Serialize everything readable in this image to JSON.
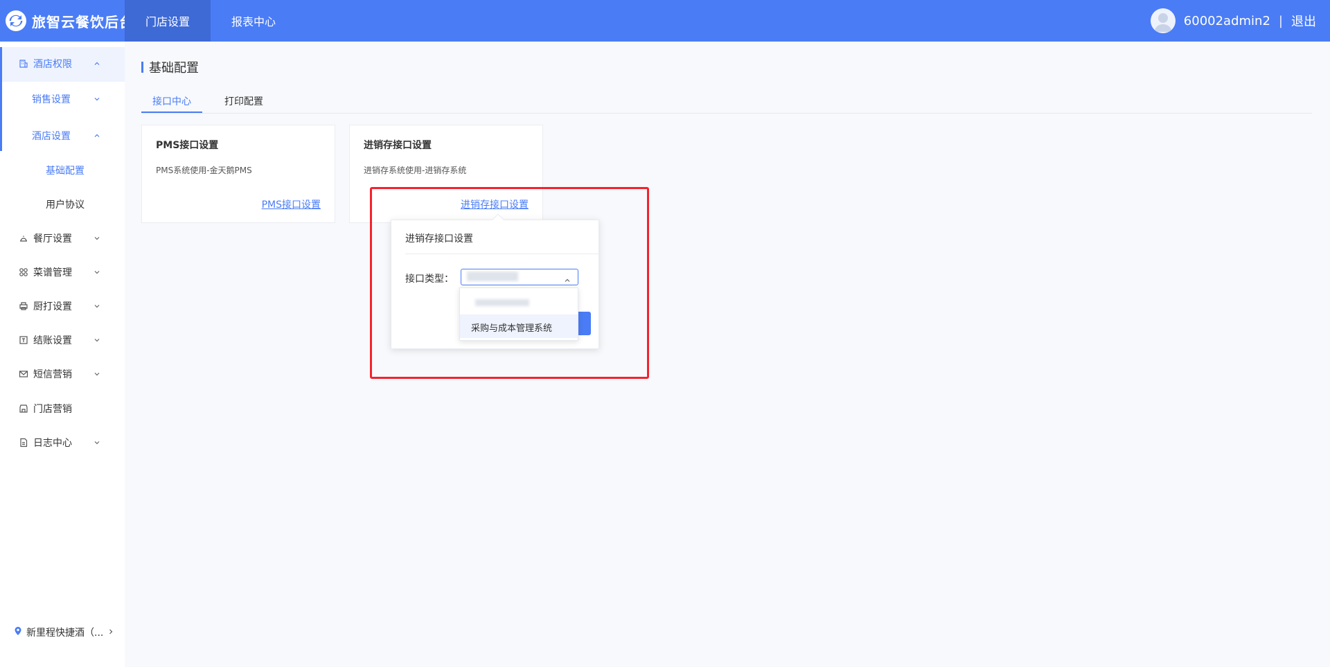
{
  "header": {
    "app_name": "旅智云餐饮后台",
    "nav": [
      {
        "label": "门店设置",
        "active": true
      },
      {
        "label": "报表中心",
        "active": false
      }
    ],
    "username": "60002admin2",
    "separator": "|",
    "logout_label": "退出"
  },
  "sidebar": {
    "items": [
      {
        "label": "酒店权限",
        "icon": "building-icon",
        "expanded": true
      },
      {
        "label": "销售设置",
        "expanded": false
      },
      {
        "label": "酒店设置",
        "expanded": true
      },
      {
        "label": "基础配置",
        "selected": true
      },
      {
        "label": "用户协议"
      },
      {
        "label": "餐厅设置",
        "icon": "bell-icon"
      },
      {
        "label": "菜谱管理",
        "icon": "grid-icon"
      },
      {
        "label": "厨打设置",
        "icon": "printer-icon"
      },
      {
        "label": "结账设置",
        "icon": "checkout-icon"
      },
      {
        "label": "短信营销",
        "icon": "mail-icon"
      },
      {
        "label": "门店营销",
        "icon": "store-icon"
      },
      {
        "label": "日志中心",
        "icon": "document-icon"
      }
    ],
    "location": "新里程快捷酒（..."
  },
  "main": {
    "page_title": "基础配置",
    "tabs": [
      {
        "label": "接口中心",
        "active": true
      },
      {
        "label": "打印配置",
        "active": false
      }
    ],
    "cards": [
      {
        "title": "PMS接口设置",
        "desc": "PMS系统使用-金天鹅PMS",
        "link": "PMS接口设置"
      },
      {
        "title": "进销存接口设置",
        "desc": "进销存系统使用-进销存系统",
        "link": "进销存接口设置"
      }
    ],
    "popover": {
      "title": "进销存接口设置",
      "field_label": "接口类型：",
      "options": [
        "",
        "采购与成本管理系统"
      ]
    }
  },
  "colors": {
    "primary": "#4a7cf6",
    "highlight_border": "#f5222d"
  }
}
